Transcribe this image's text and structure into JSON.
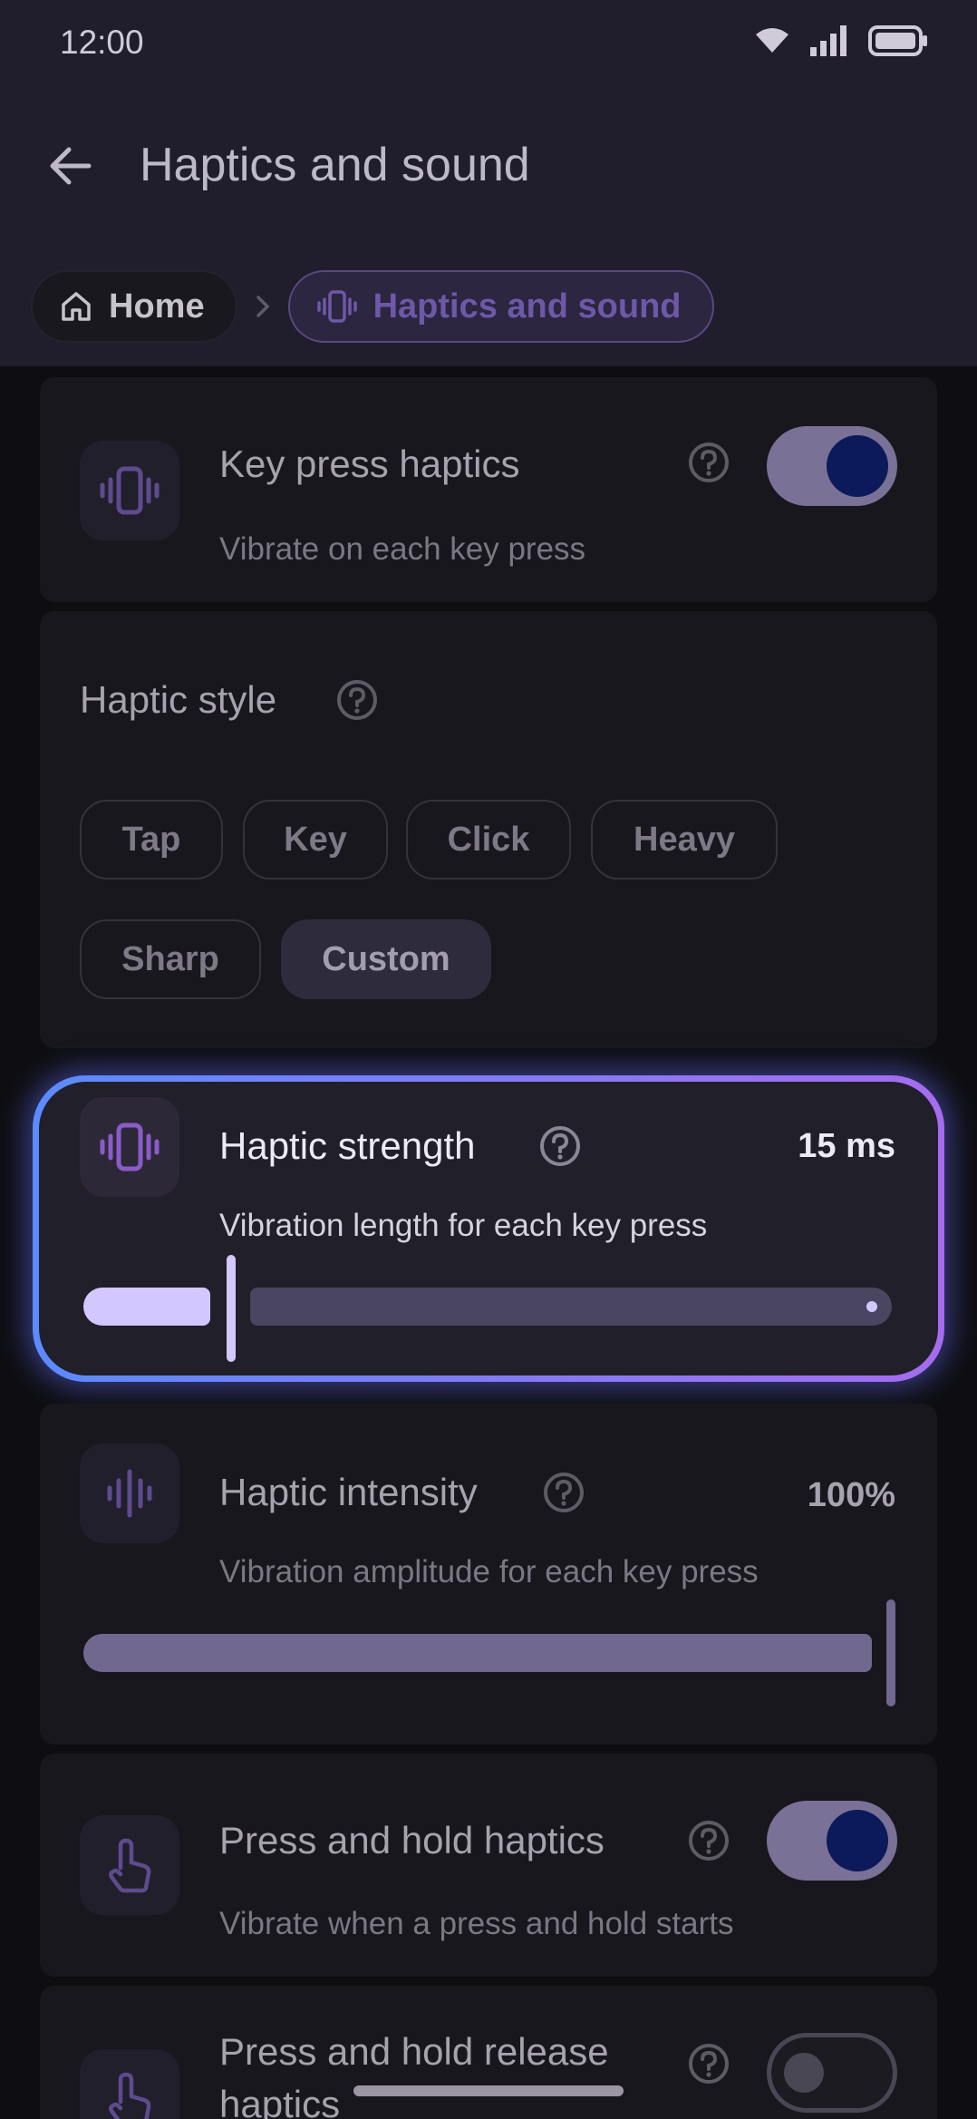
{
  "status_bar": {
    "time": "12:00"
  },
  "header": {
    "title": "Haptics and sound"
  },
  "breadcrumb": {
    "home": "Home",
    "current": "Haptics and sound"
  },
  "key_press": {
    "title": "Key press haptics",
    "subtitle": "Vibrate on each key press",
    "enabled": true
  },
  "haptic_style": {
    "title": "Haptic style",
    "options": [
      "Tap",
      "Key",
      "Click",
      "Heavy",
      "Sharp",
      "Custom"
    ],
    "selected": "Custom"
  },
  "strength": {
    "title": "Haptic strength",
    "value": "15 ms",
    "subtitle": "Vibration length for each key press",
    "fraction": 0.17
  },
  "intensity": {
    "title": "Haptic intensity",
    "value": "100%",
    "subtitle": "Vibration amplitude for each key press",
    "fraction": 1.0
  },
  "press_hold": {
    "title": "Press and hold haptics",
    "subtitle": "Vibrate when a press and hold starts",
    "enabled": true
  },
  "press_hold_release": {
    "title_line1": "Press and hold release",
    "title_line2": "haptics",
    "enabled": false
  },
  "colors": {
    "header_bg": "#201e2d",
    "accent": "#6e58a8",
    "focus_ring_start": "#5b8bff",
    "focus_ring_end": "#a66cf0"
  }
}
